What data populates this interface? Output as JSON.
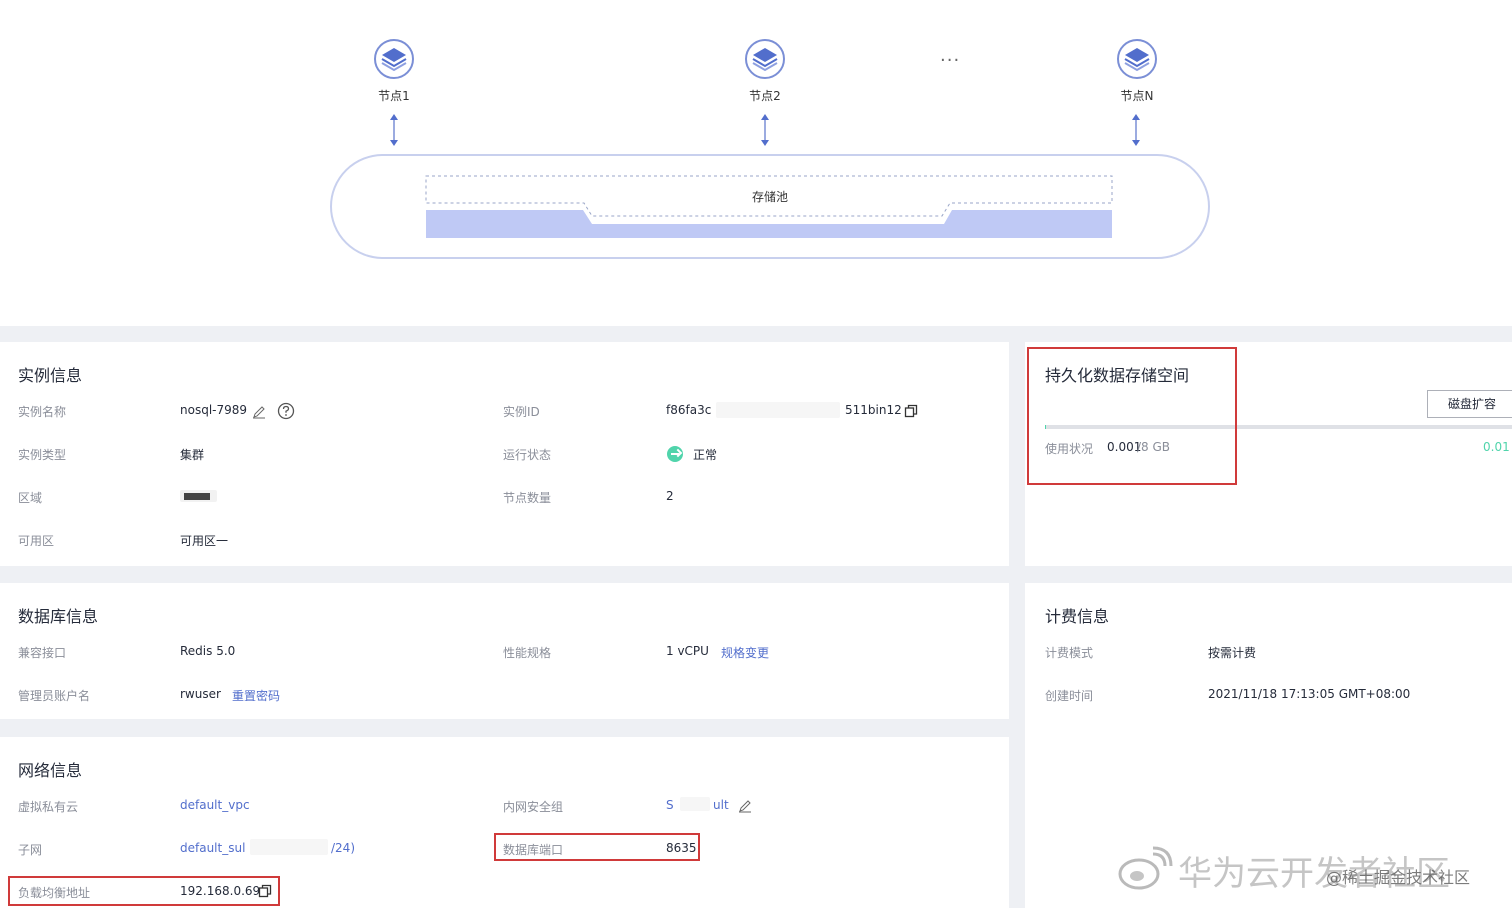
{
  "diagram": {
    "nodes": [
      {
        "label": "节点1"
      },
      {
        "label": "节点2"
      },
      {
        "label": "节点N"
      }
    ],
    "ellipsis": "···",
    "pool_label": "存储池",
    "colors": {
      "node": "#526ecc",
      "pool_fill": "#bfc9f5",
      "pool_border": "#c8d0ee"
    }
  },
  "instance_info": {
    "title": "实例信息",
    "name_label": "实例名称",
    "name_value": "nosql-7989",
    "id_label": "实例ID",
    "id_value_start": "f86fa3c",
    "id_value_end": "511bin12",
    "type_label": "实例类型",
    "type_value": "集群",
    "status_label": "运行状态",
    "status_value": "正常",
    "region_label": "区域",
    "node_count_label": "节点数量",
    "node_count_value": "2",
    "az_label": "可用区",
    "az_value": "可用区一"
  },
  "storage": {
    "title": "持久化数据存储空间",
    "expand_button": "磁盘扩容",
    "usage_label": "使用状况",
    "usage_used": "0.001",
    "usage_total": "/8 GB",
    "usage_percent_text": "0.01",
    "usage_fraction": 0.0001
  },
  "db_info": {
    "title": "数据库信息",
    "compat_label": "兼容接口",
    "compat_value": "Redis 5.0",
    "spec_label": "性能规格",
    "spec_value": "1 vCPU",
    "spec_change_link": "规格变更",
    "admin_label": "管理员账户名",
    "admin_value": "rwuser",
    "reset_pwd_link": "重置密码"
  },
  "billing": {
    "title": "计费信息",
    "mode_label": "计费模式",
    "mode_value": "按需计费",
    "created_label": "创建时间",
    "created_value": "2021/11/18 17:13:05 GMT+08:00"
  },
  "network": {
    "title": "网络信息",
    "vpc_label": "虚拟私有云",
    "vpc_value": "default_vpc",
    "sg_label": "内网安全组",
    "sg_value_start": "S",
    "sg_value_end": "ult",
    "subnet_label": "子网",
    "subnet_value_start": "default_sul",
    "subnet_value_end": "/24)",
    "port_label": "数据库端口",
    "port_value": "8635",
    "lb_label": "负载均衡地址",
    "lb_value": "192.168.0.69"
  },
  "watermark": {
    "main": "华为云开发者社区",
    "sub": "@稀土掘金技术社区"
  }
}
